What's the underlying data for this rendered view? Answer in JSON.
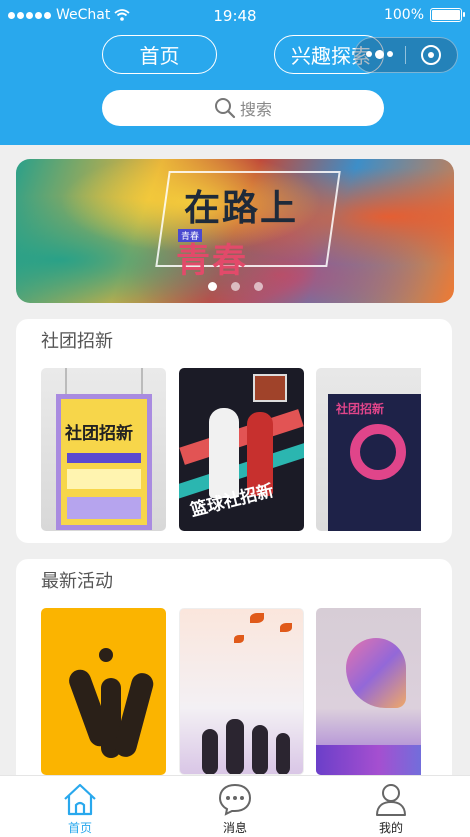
{
  "status_bar": {
    "carrier": "WeChat",
    "time": "19:48",
    "battery": "100%"
  },
  "header": {
    "nav_home": "首页",
    "nav_interest": "兴趣探索",
    "search_placeholder": "搜索"
  },
  "banner": {
    "title_line1": "在路上",
    "tag": "青春",
    "title_line2": "青春",
    "active_slide": 1,
    "slide_count": 3
  },
  "recruit_section": {
    "title": "社团招新",
    "cards": [
      {
        "poster_text": "社团招新"
      },
      {
        "poster_text": "篮球社招新"
      },
      {
        "poster_text": "社团招新"
      }
    ]
  },
  "activity_section": {
    "title": "最新活动",
    "cards": [
      {
        "poster_text": ""
      },
      {
        "poster_text": ""
      },
      {
        "poster_text": ""
      }
    ]
  },
  "tabbar": {
    "items": [
      {
        "label": "首页",
        "icon": "home-icon",
        "active": true
      },
      {
        "label": "消息",
        "icon": "message-icon",
        "active": false
      },
      {
        "label": "我的",
        "icon": "user-icon",
        "active": false
      }
    ]
  },
  "colors": {
    "primary": "#29a8ed",
    "background": "#efefef"
  }
}
